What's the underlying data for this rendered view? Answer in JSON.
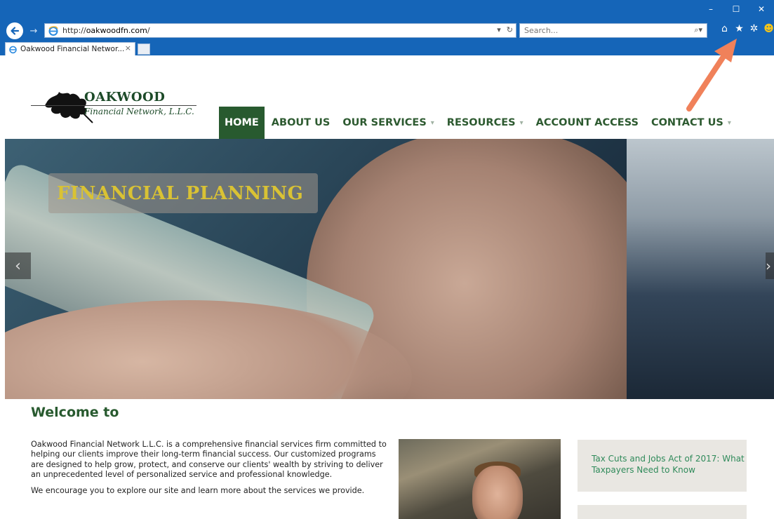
{
  "browser": {
    "url_prefix": "http://",
    "url_host": "oakwoodfn.com",
    "url_suffix": "/",
    "search_placeholder": "Search...",
    "tab_title": "Oakwood Financial Networ...",
    "tab_close": "×",
    "window_controls": [
      "–",
      "☐",
      "✕"
    ],
    "toolbar_icons": [
      "home-icon",
      "favorites-star-icon",
      "settings-gear-icon",
      "smiley-feedback-icon"
    ]
  },
  "site": {
    "logo_name": "OAKWOOD",
    "logo_sub": "Financial Network, L.L.C.",
    "nav": [
      {
        "label": "HOME",
        "active": true,
        "dropdown": false
      },
      {
        "label": "ABOUT US",
        "active": false,
        "dropdown": false
      },
      {
        "label": "OUR SERVICES",
        "active": false,
        "dropdown": true
      },
      {
        "label": "RESOURCES",
        "active": false,
        "dropdown": true
      },
      {
        "label": "ACCOUNT ACCESS",
        "active": false,
        "dropdown": false
      },
      {
        "label": "CONTACT US",
        "active": false,
        "dropdown": true
      }
    ],
    "hero_caption": "FINANCIAL PLANNING",
    "welcome_heading": "Welcome to",
    "intro_p1": "Oakwood Financial Network L.L.C. is a comprehensive financial services firm committed to helping our clients improve their long-term financial success. Our customized programs are designed to help grow, protect, and conserve our clients' wealth by striving to deliver an unprecedented level of personalized service and professional knowledge.",
    "intro_p2": "We encourage you to explore our site and learn more about the services we provide.",
    "card1_title": "Tax Cuts and Jobs Act of 2017: What Taxpayers Need to Know"
  },
  "colors": {
    "chrome_blue": "#1565b8",
    "brand_green": "#285a2f",
    "caption_gold": "#d9c234",
    "annotation_arrow": "#f0815a"
  }
}
